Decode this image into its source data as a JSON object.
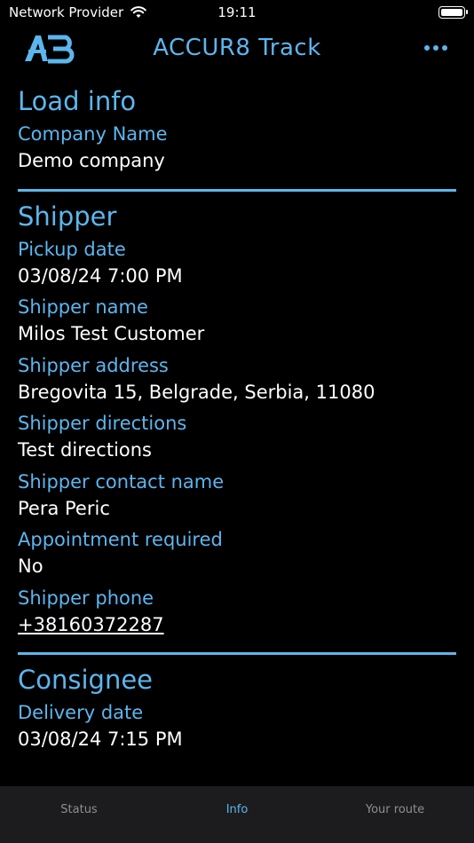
{
  "status_bar": {
    "carrier": "Network Provider",
    "time": "19:11",
    "wifi_icon": "wifi-icon",
    "battery_icon": "battery-icon"
  },
  "header": {
    "logo_icon": "accur8-logo",
    "title": "ACCUR8 Track",
    "menu_icon": "more-icon"
  },
  "load_info": {
    "title": "Load info",
    "company_name_label": "Company Name",
    "company_name": "Demo company"
  },
  "shipper": {
    "title": "Shipper",
    "fields": [
      {
        "label": "Pickup date",
        "value": "03/08/24 7:00 PM"
      },
      {
        "label": "Shipper name",
        "value": "Milos Test Customer"
      },
      {
        "label": "Shipper address",
        "value": "Bregovita 15, Belgrade, Serbia, 11080"
      },
      {
        "label": "Shipper directions",
        "value": "Test directions"
      },
      {
        "label": "Shipper contact name",
        "value": "Pera Peric"
      },
      {
        "label": "Appointment required",
        "value": "No"
      },
      {
        "label": "Shipper phone",
        "value": "+38160372287"
      }
    ]
  },
  "consignee": {
    "title": "Consignee",
    "delivery_date_label": "Delivery date",
    "delivery_date": "03/08/24 7:15 PM"
  },
  "tabs": [
    {
      "label": "Status"
    },
    {
      "label": "Info"
    },
    {
      "label": "Your route"
    }
  ],
  "colors": {
    "accent": "#5cb6ee",
    "background": "#000000",
    "tabbar": "#1c1c1e"
  }
}
